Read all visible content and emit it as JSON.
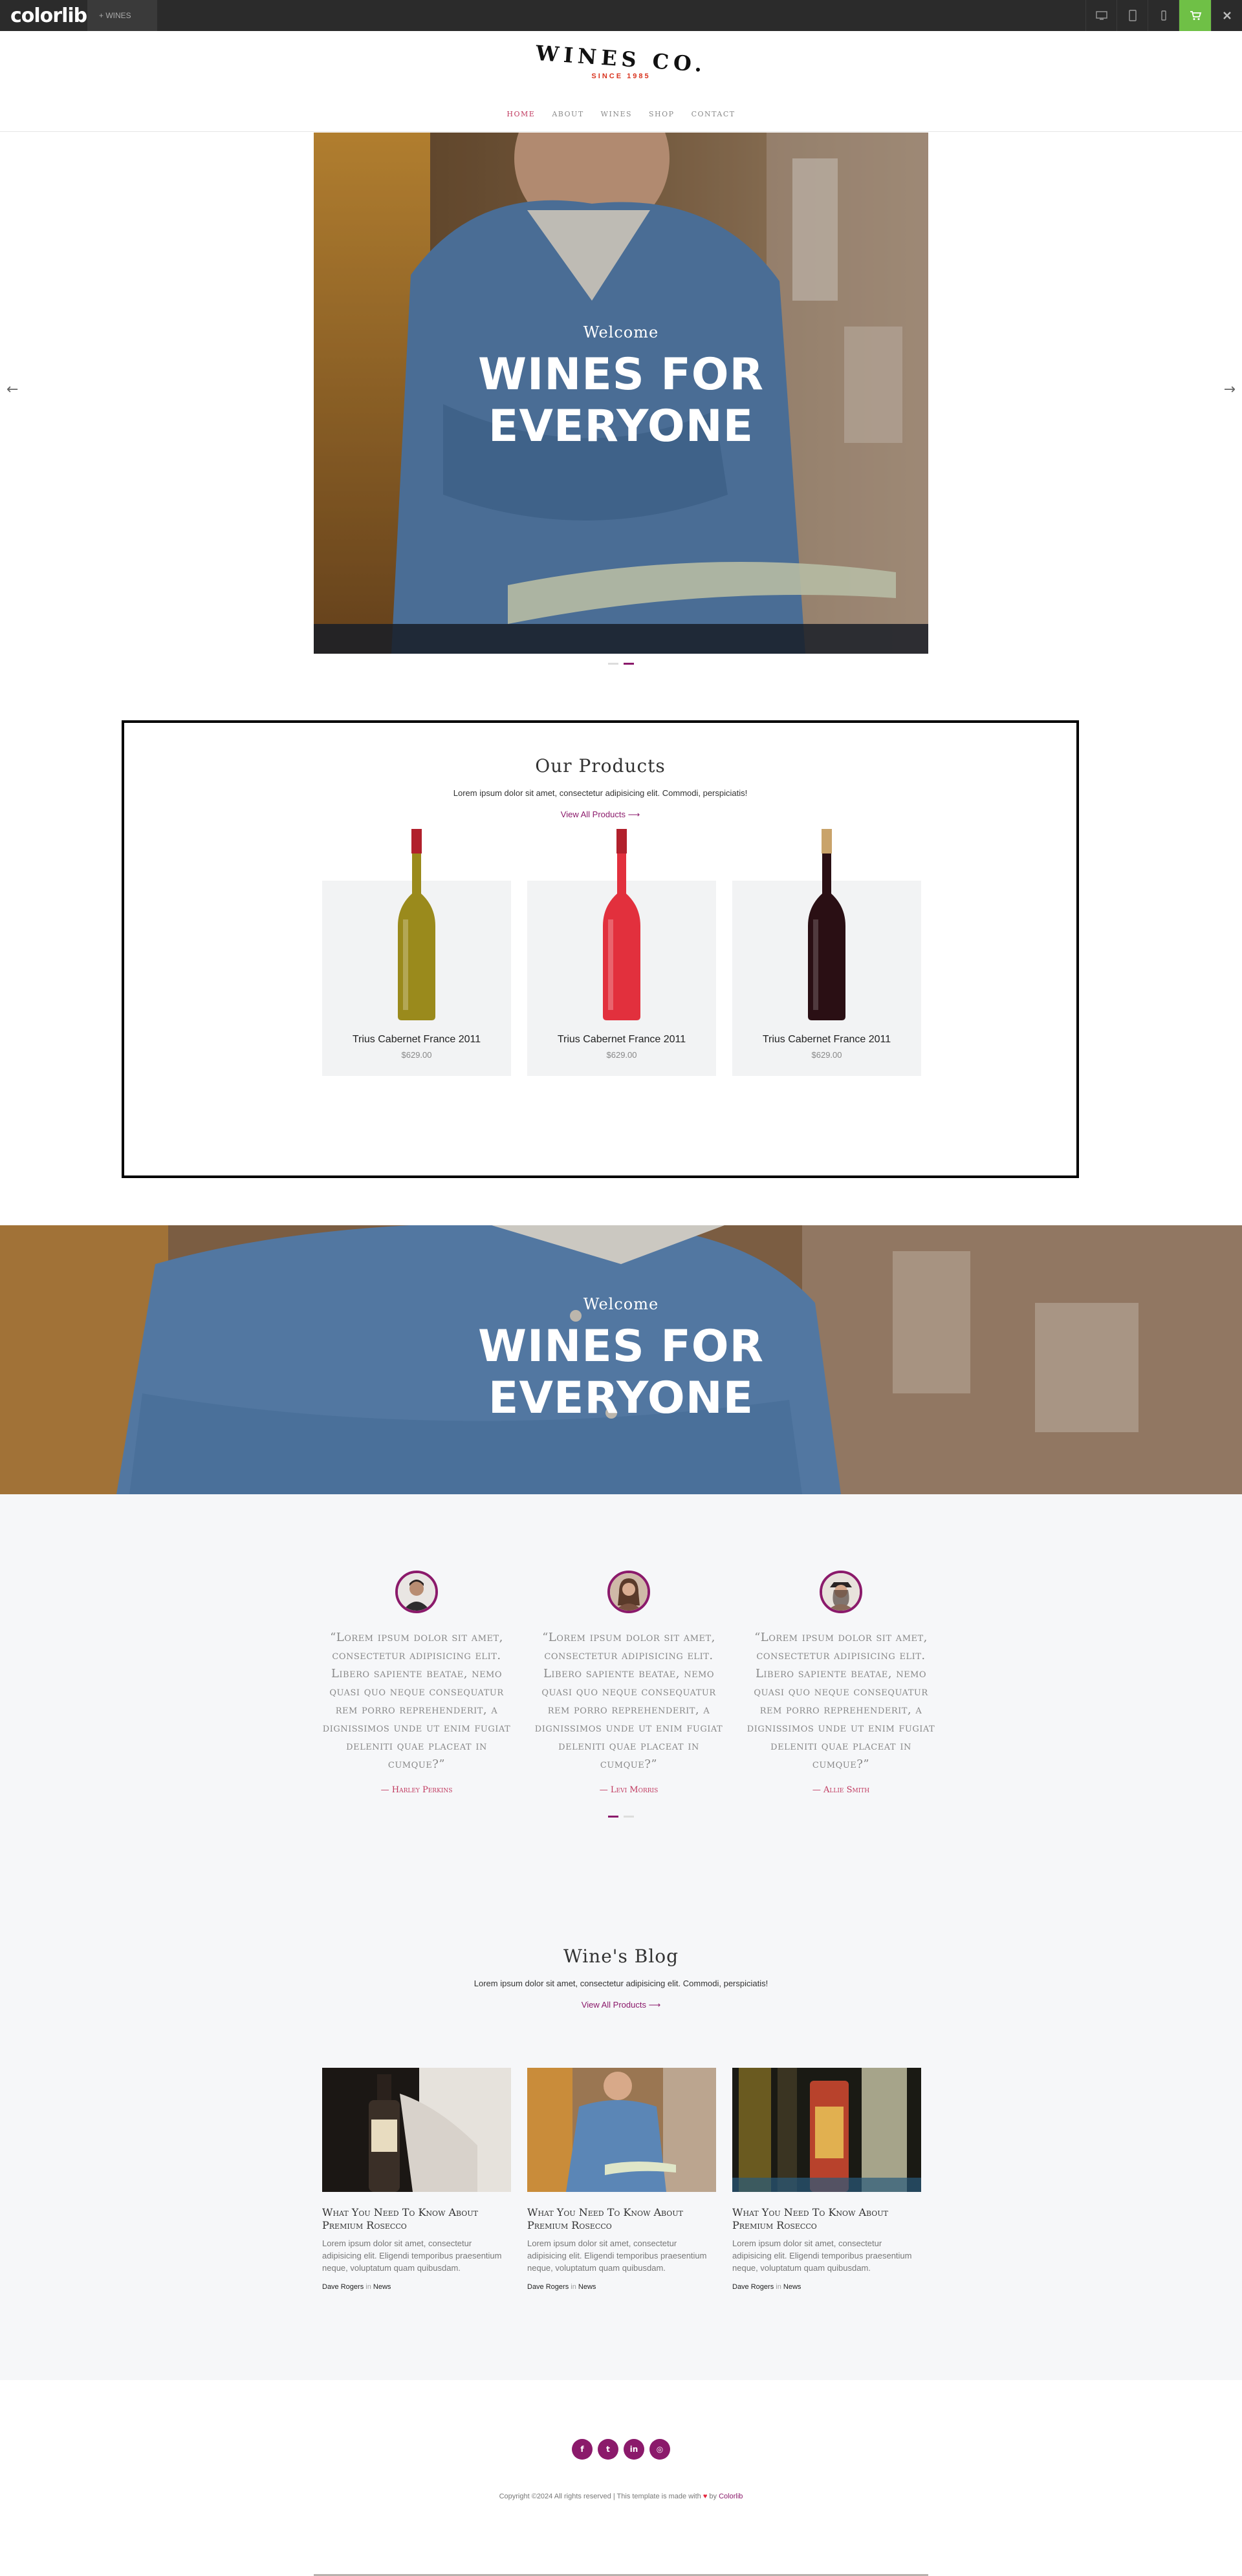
{
  "topbar": {
    "logo": "colorlib.",
    "theme_tab": "+ WINES",
    "device_icons": [
      "desktop-icon",
      "tablet-icon",
      "mobile-icon",
      "cart-icon",
      "close-icon"
    ],
    "accent_color": "#6fc046"
  },
  "header": {
    "brand": "WINES CO.",
    "since": "SINCE 1985",
    "nav": [
      "HOME",
      "ABOUT",
      "WINES",
      "SHOP",
      "CONTACT"
    ],
    "active_nav": "HOME"
  },
  "hero": {
    "welcome": "Welcome",
    "title_line1": "WINES FOR",
    "title_line2": "EVERYONE",
    "prev_arrow": "←",
    "next_arrow": "→",
    "slide_count": 2,
    "active_slide": 2
  },
  "products": {
    "title": "Our Products",
    "subtitle": "Lorem ipsum dolor sit amet, consectetur adipisicing elit. Commodi, perspiciatis!",
    "link": "View All Products ⟶",
    "items": [
      {
        "name": "Trius Cabernet France 2011",
        "price": "$629.00",
        "wine_color": "#9a8a1c"
      },
      {
        "name": "Trius Cabernet France 2011",
        "price": "$629.00",
        "wine_color": "#e2303d"
      },
      {
        "name": "Trius Cabernet France 2011",
        "price": "$629.00",
        "wine_color": "#2a0f14"
      }
    ]
  },
  "parallax": {
    "welcome": "Welcome",
    "title_line1": "WINES FOR",
    "title_line2": "EVERYONE"
  },
  "testimonials": {
    "items": [
      {
        "quote": "“Lorem ipsum dolor sit amet, consectetur adipisicing elit. Libero sapiente beatae, nemo quasi quo neque consequatur rem porro reprehenderit, a dignissimos unde ut enim fugiat deleniti quae placeat in cumque?”",
        "author": "— Harley Perkins"
      },
      {
        "quote": "“Lorem ipsum dolor sit amet, consectetur adipisicing elit. Libero sapiente beatae, nemo quasi quo neque consequatur rem porro reprehenderit, a dignissimos unde ut enim fugiat deleniti quae placeat in cumque?”",
        "author": "— Levi Morris"
      },
      {
        "quote": "“Lorem ipsum dolor sit amet, consectetur adipisicing elit. Libero sapiente beatae, nemo quasi quo neque consequatur rem porro reprehenderit, a dignissimos unde ut enim fugiat deleniti quae placeat in cumque?”",
        "author": "— Allie Smith"
      }
    ]
  },
  "blog": {
    "title": "Wine's Blog",
    "subtitle": "Lorem ipsum dolor sit amet, consectetur adipisicing elit. Commodi, perspiciatis!",
    "link": "View All Products ⟶",
    "posts": [
      {
        "title": "What You Need To Know About Premium Rosecco",
        "excerpt": "Lorem ipsum dolor sit amet, consectetur adipisicing elit. Eligendi temporibus praesentium neque, voluptatum quam quibusdam.",
        "author": "Dave Rogers",
        "in": "in",
        "category": "News"
      },
      {
        "title": "What You Need To Know About Premium Rosecco",
        "excerpt": "Lorem ipsum dolor sit amet, consectetur adipisicing elit. Eligendi temporibus praesentium neque, voluptatum quam quibusdam.",
        "author": "Dave Rogers",
        "in": "in",
        "category": "News"
      },
      {
        "title": "What You Need To Know About Premium Rosecco",
        "excerpt": "Lorem ipsum dolor sit amet, consectetur adipisicing elit. Eligendi temporibus praesentium neque, voluptatum quam quibusdam.",
        "author": "Dave Rogers",
        "in": "in",
        "category": "News"
      }
    ]
  },
  "footer": {
    "social_icons": [
      "facebook-icon",
      "twitter-icon",
      "linkedin-icon",
      "instagram-icon"
    ],
    "social_glyphs": [
      "f",
      "t",
      "in",
      "◎"
    ],
    "copy_prefix": "Copyright ©2024 All rights reserved | This template is made with",
    "heart": "♥",
    "by": "by",
    "author_link": "Colorlib",
    "brand_color": "#8b1a6b"
  }
}
